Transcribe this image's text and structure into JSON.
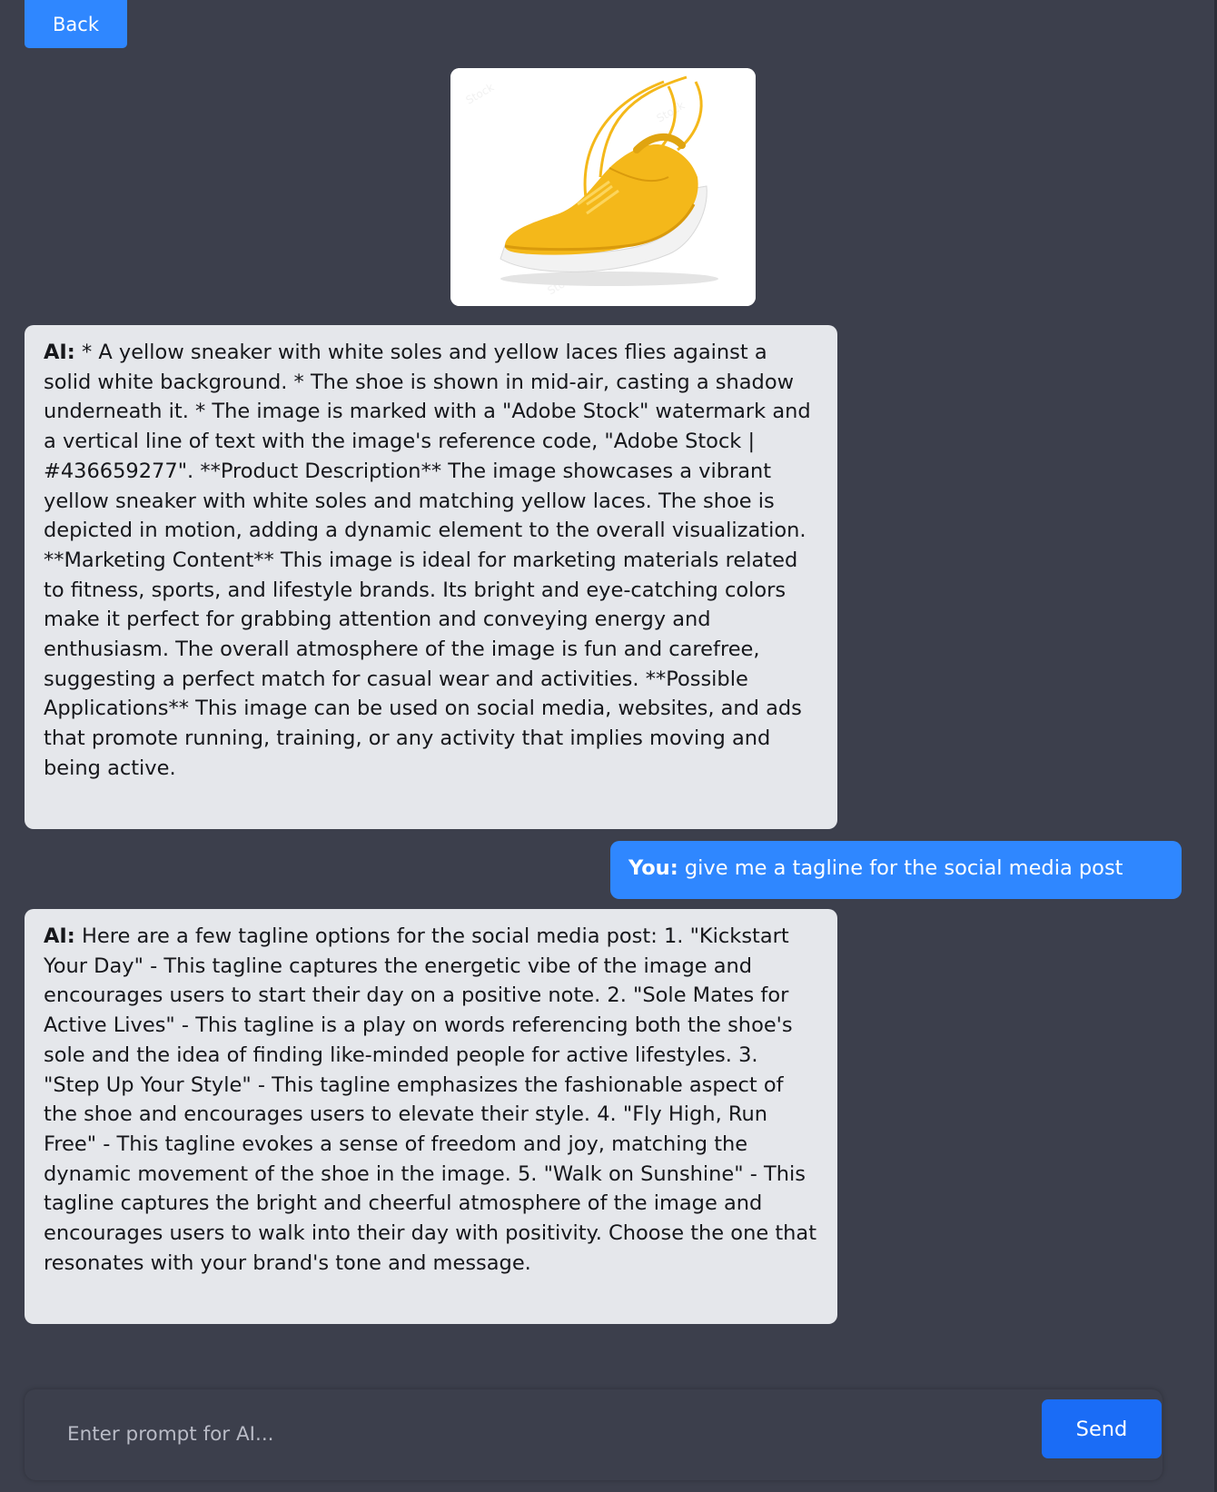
{
  "toolbar": {
    "back_label": "Back"
  },
  "image": {
    "alt": "Yellow sneaker with white sole",
    "colors": {
      "shoe": "#f4b81a",
      "shoe_dark": "#d99a0c",
      "sole": "#f2f2f2"
    }
  },
  "conversation": {
    "messages": [
      {
        "speaker": "AI:",
        "text": " * A yellow sneaker with white soles and yellow laces flies against a solid white background. * The shoe is shown in mid-air, casting a shadow underneath it. * The image is marked with a \"Adobe Stock\" watermark and a vertical line of text with the image's reference code, \"Adobe Stock | #436659277\". **Product Description** The image showcases a vibrant yellow sneaker with white soles and matching yellow laces. The shoe is depicted in motion, adding a dynamic element to the overall visualization. **Marketing Content** This image is ideal for marketing materials related to fitness, sports, and lifestyle brands. Its bright and eye-catching colors make it perfect for grabbing attention and conveying energy and enthusiasm. The overall atmosphere of the image is fun and carefree, suggesting a perfect match for casual wear and activities. **Possible Applications** This image can be used on social media, websites, and ads that promote running, training, or any activity that implies moving and being active."
      },
      {
        "speaker": "You:",
        "text": " give me a tagline for the social media post"
      },
      {
        "speaker": "AI:",
        "text": " Here are a few tagline options for the social media post: 1. \"Kickstart Your Day\" - This tagline captures the energetic vibe of the image and encourages users to start their day on a positive note. 2. \"Sole Mates for Active Lives\" - This tagline is a play on words referencing both the shoe's sole and the idea of finding like-minded people for active lifestyles. 3. \"Step Up Your Style\" - This tagline emphasizes the fashionable aspect of the shoe and encourages users to elevate their style. 4. \"Fly High, Run Free\" - This tagline evokes a sense of freedom and joy, matching the dynamic movement of the shoe in the image. 5. \"Walk on Sunshine\" - This tagline captures the bright and cheerful atmosphere of the image and encourages users to walk into their day with positivity. Choose the one that resonates with your brand's tone and message."
      }
    ]
  },
  "composer": {
    "placeholder": "Enter prompt for AI...",
    "value": "",
    "send_label": "Send"
  },
  "colors": {
    "background": "#3c3f4c",
    "ai_bubble": "#e5e7eb",
    "user_bubble": "#2f87ff",
    "send_button": "#1a6cf6"
  }
}
